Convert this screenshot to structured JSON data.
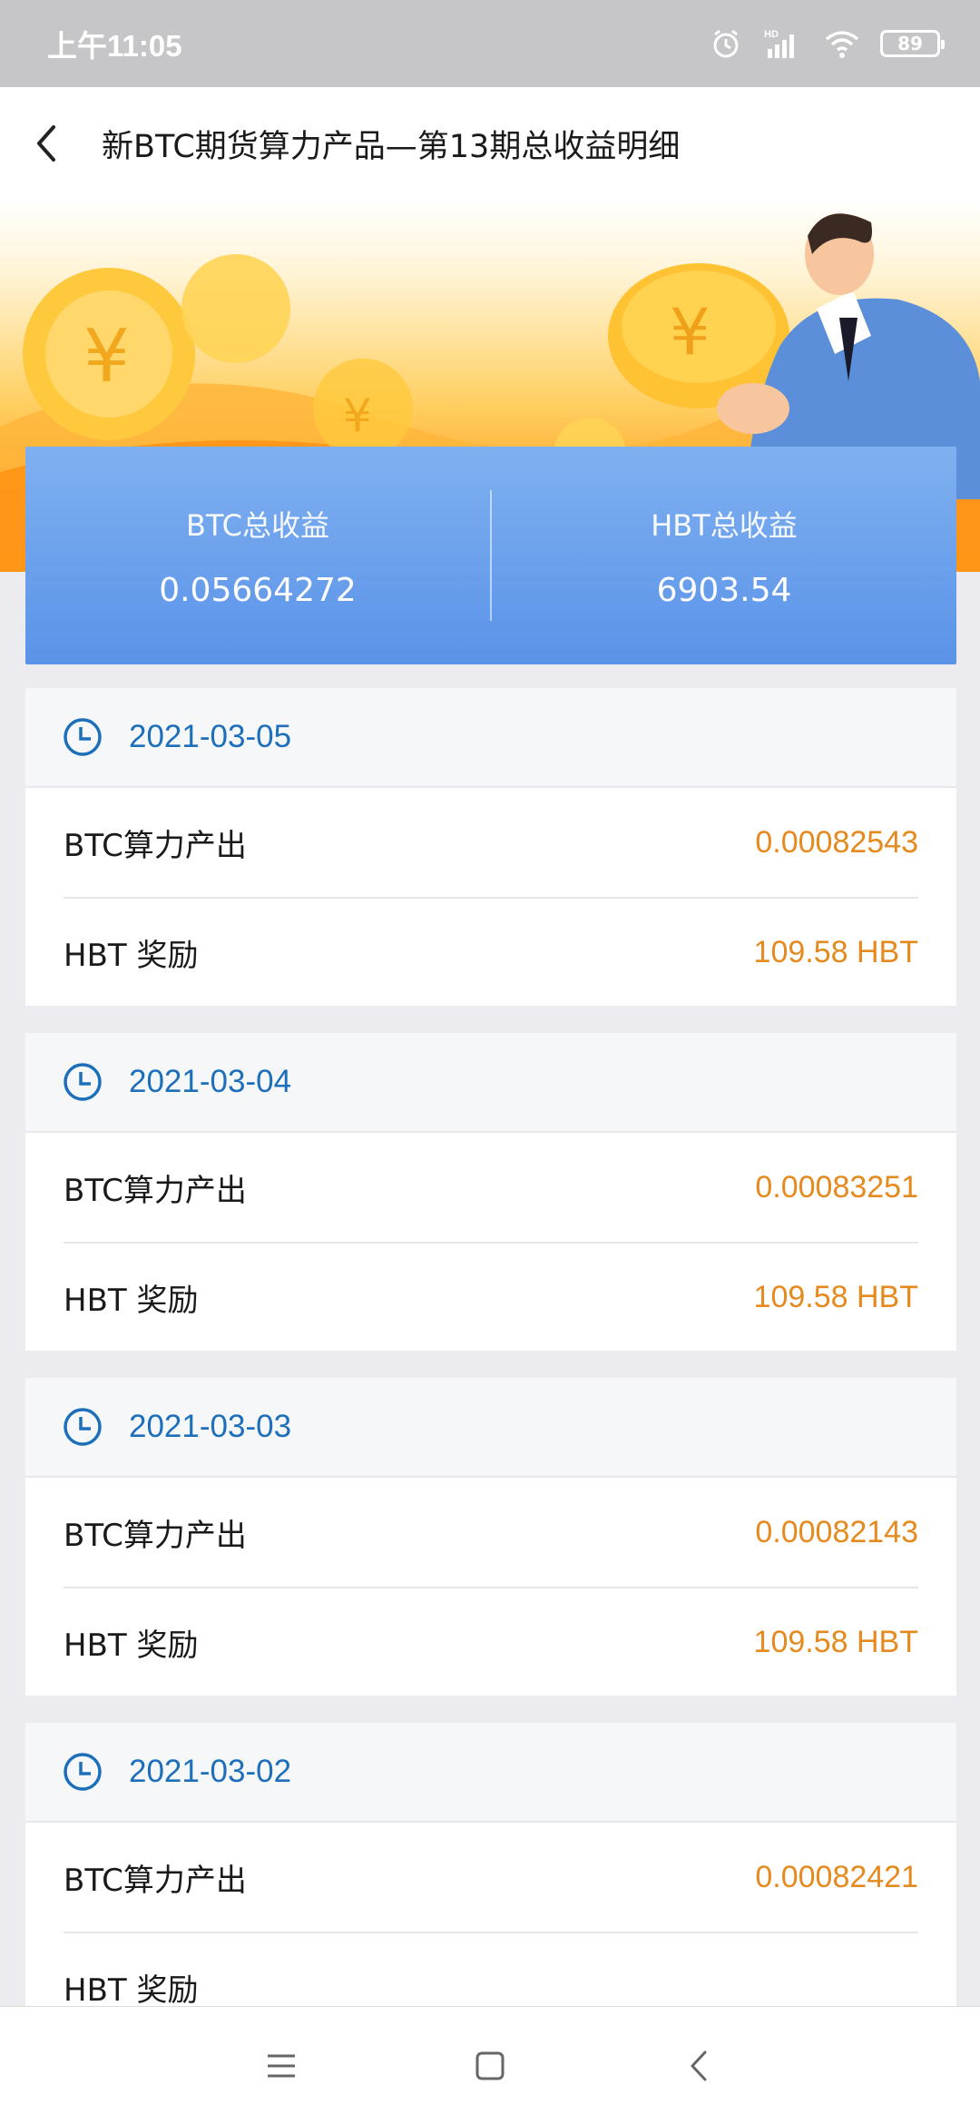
{
  "status_bar": {
    "time": "上午11:05",
    "battery": "89",
    "network": "HD"
  },
  "header": {
    "title": "新BTC期货算力产品—第13期总收益明细"
  },
  "summary": {
    "btc_label": "BTC总收益",
    "btc_value": "0.05664272",
    "hbt_label": "HBT总收益",
    "hbt_value": "6903.54"
  },
  "records": [
    {
      "date": "2021-03-05",
      "btc_label": "BTC算力产出",
      "btc_value": "0.00082543",
      "hbt_label": "HBT 奖励",
      "hbt_value": "109.58 HBT"
    },
    {
      "date": "2021-03-04",
      "btc_label": "BTC算力产出",
      "btc_value": "0.00083251",
      "hbt_label": "HBT 奖励",
      "hbt_value": "109.58 HBT"
    },
    {
      "date": "2021-03-03",
      "btc_label": "BTC算力产出",
      "btc_value": "0.00082143",
      "hbt_label": "HBT 奖励",
      "hbt_value": "109.58 HBT"
    },
    {
      "date": "2021-03-02",
      "btc_label": "BTC算力产出",
      "btc_value": "0.00082421",
      "hbt_label": "HBT 奖励",
      "hbt_value": ""
    }
  ],
  "colors": {
    "accent_blue": "#1e6fba",
    "value_orange": "#e58a1f",
    "summary_blue": "#5a93e8"
  }
}
